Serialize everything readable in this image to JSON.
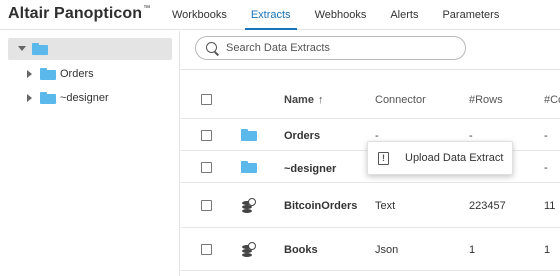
{
  "app": {
    "brand": "Altair Panopticon",
    "brand_mark": "™"
  },
  "nav": {
    "tabs": [
      {
        "label": "Workbooks",
        "active": false
      },
      {
        "label": "Extracts",
        "active": true
      },
      {
        "label": "Webhooks",
        "active": false
      },
      {
        "label": "Alerts",
        "active": false
      },
      {
        "label": "Parameters",
        "active": false
      }
    ]
  },
  "tree": {
    "items": [
      {
        "label": "Orders",
        "icon": "folder-icon"
      },
      {
        "label": "~designer",
        "icon": "folder-icon"
      }
    ]
  },
  "search": {
    "placeholder": "Search Data Extracts",
    "value": ""
  },
  "table": {
    "headers": {
      "name": "Name",
      "sort_indicator": "↑",
      "connector": "Connector",
      "rows": "#Rows",
      "columns": "#Co"
    },
    "rows": [
      {
        "icon": "folder-icon",
        "name": "Orders",
        "connector": "-",
        "rows": "-",
        "columns": "-"
      },
      {
        "icon": "folder-icon",
        "name": "~designer",
        "connector": "",
        "rows": "",
        "columns": "-"
      },
      {
        "icon": "database-icon",
        "name": "BitcoinOrders",
        "connector": "Text",
        "rows": "223457",
        "columns": "11"
      },
      {
        "icon": "database-icon",
        "name": "Books",
        "connector": "Json",
        "rows": "1",
        "columns": "1"
      }
    ]
  },
  "context_menu": {
    "items": [
      {
        "label": "Upload Data Extract",
        "icon": "upload-file-icon"
      }
    ]
  },
  "colors": {
    "accent": "#1a73b8",
    "folder": "#5bb8ea",
    "selected_bg": "#e4e4e4"
  }
}
